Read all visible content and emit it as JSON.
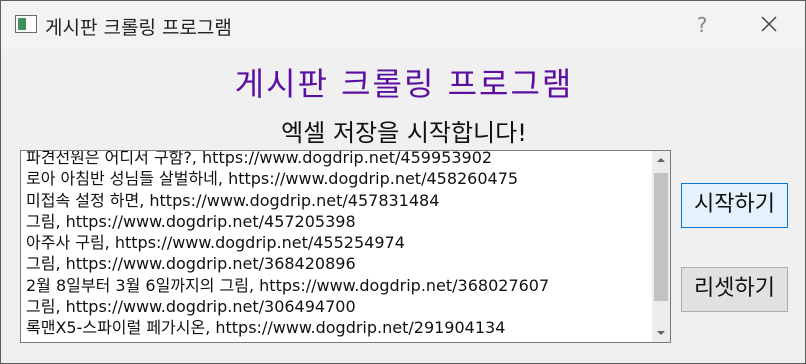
{
  "window": {
    "title": "게시판 크롤링 프로그램",
    "help_label": "?"
  },
  "main": {
    "heading": "게시판 크롤링 프로그램",
    "status": "엑셀 저장을 시작합니다!",
    "list_items": [
      "파견선원은 어디서 구함?, https://www.dogdrip.net/459953902",
      "로아 아침반 성님들 살벌하네, https://www.dogdrip.net/458260475",
      "미접속 설정 하면, https://www.dogdrip.net/457831484",
      "그림, https://www.dogdrip.net/457205398",
      "아주사 구림, https://www.dogdrip.net/455254974",
      "그림, https://www.dogdrip.net/368420896",
      "2월 8일부터 3월 6일까지의 그림, https://www.dogdrip.net/368027607",
      "그림, https://www.dogdrip.net/306494700",
      "록맨X5-스파이럴 페가시온, https://www.dogdrip.net/291904134"
    ]
  },
  "buttons": {
    "start_label": "시작하기",
    "reset_label": "리셋하기"
  }
}
